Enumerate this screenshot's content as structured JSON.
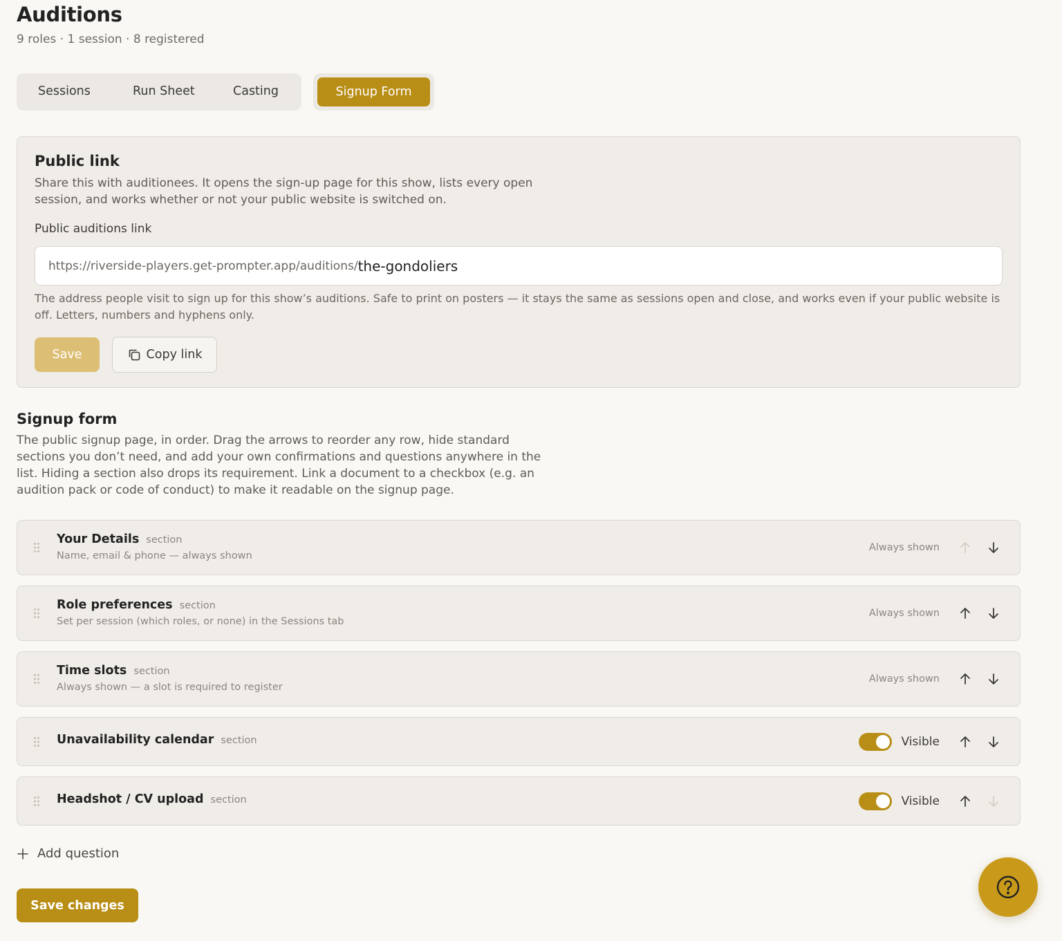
{
  "header": {
    "title": "Auditions",
    "subtitle": "9 roles · 1 session · 8 registered"
  },
  "tabs": [
    {
      "label": "Sessions",
      "active": false
    },
    {
      "label": "Run Sheet",
      "active": false
    },
    {
      "label": "Casting",
      "active": false
    },
    {
      "label": "Signup Form",
      "active": true
    }
  ],
  "public_link": {
    "title": "Public link",
    "description": "Share this with auditionees. It opens the sign-up page for this show, lists every open session, and works whether or not your public website is switched on.",
    "field_label": "Public auditions link",
    "url_prefix": "https://riverside-players.get-prompter.app/auditions/",
    "slug": "the-gondoliers",
    "help": "The address people visit to sign up for this show’s auditions. Safe to print on posters — it stays the same as sessions open and close, and works even if your public website is off. Letters, numbers and hyphens only.",
    "save_label": "Save",
    "copy_label": "Copy link"
  },
  "signup_form": {
    "title": "Signup form",
    "description": "The public signup page, in order. Drag the arrows to reorder any row, hide standard sections you don’t need, and add your own confirmations and questions anywhere in the list. Hiding a section also drops its requirement. Link a document to a checkbox (e.g. an audition pack or code of conduct) to make it readable on the signup page.",
    "rows": [
      {
        "title": "Your Details",
        "tag": "section",
        "subtitle": "Name, email & phone — always shown",
        "status": "Always shown",
        "up_enabled": false,
        "down_enabled": true
      },
      {
        "title": "Role preferences",
        "tag": "section",
        "subtitle": "Set per session (which roles, or none) in the Sessions tab",
        "status": "Always shown",
        "up_enabled": true,
        "down_enabled": true
      },
      {
        "title": "Time slots",
        "tag": "section",
        "subtitle": "Always shown — a slot is required to register",
        "status": "Always shown",
        "up_enabled": true,
        "down_enabled": true
      },
      {
        "title": "Unavailability calendar",
        "tag": "section",
        "visible": true,
        "visible_label": "Visible",
        "up_enabled": true,
        "down_enabled": true
      },
      {
        "title": "Headshot / CV upload",
        "tag": "section",
        "visible": true,
        "visible_label": "Visible",
        "up_enabled": true,
        "down_enabled": false
      }
    ],
    "add_question_label": "Add question",
    "save_changes_label": "Save changes"
  },
  "colors": {
    "accent": "#b98e16",
    "accent_disabled": "#ddbe75",
    "background": "#f9f8f5",
    "card": "#f0ede8"
  },
  "icons": {
    "copy": "copy-icon",
    "drag": "drag-handle-icon",
    "up": "arrow-up-icon",
    "down": "arrow-down-icon",
    "add": "plus-icon",
    "help": "help-icon"
  }
}
